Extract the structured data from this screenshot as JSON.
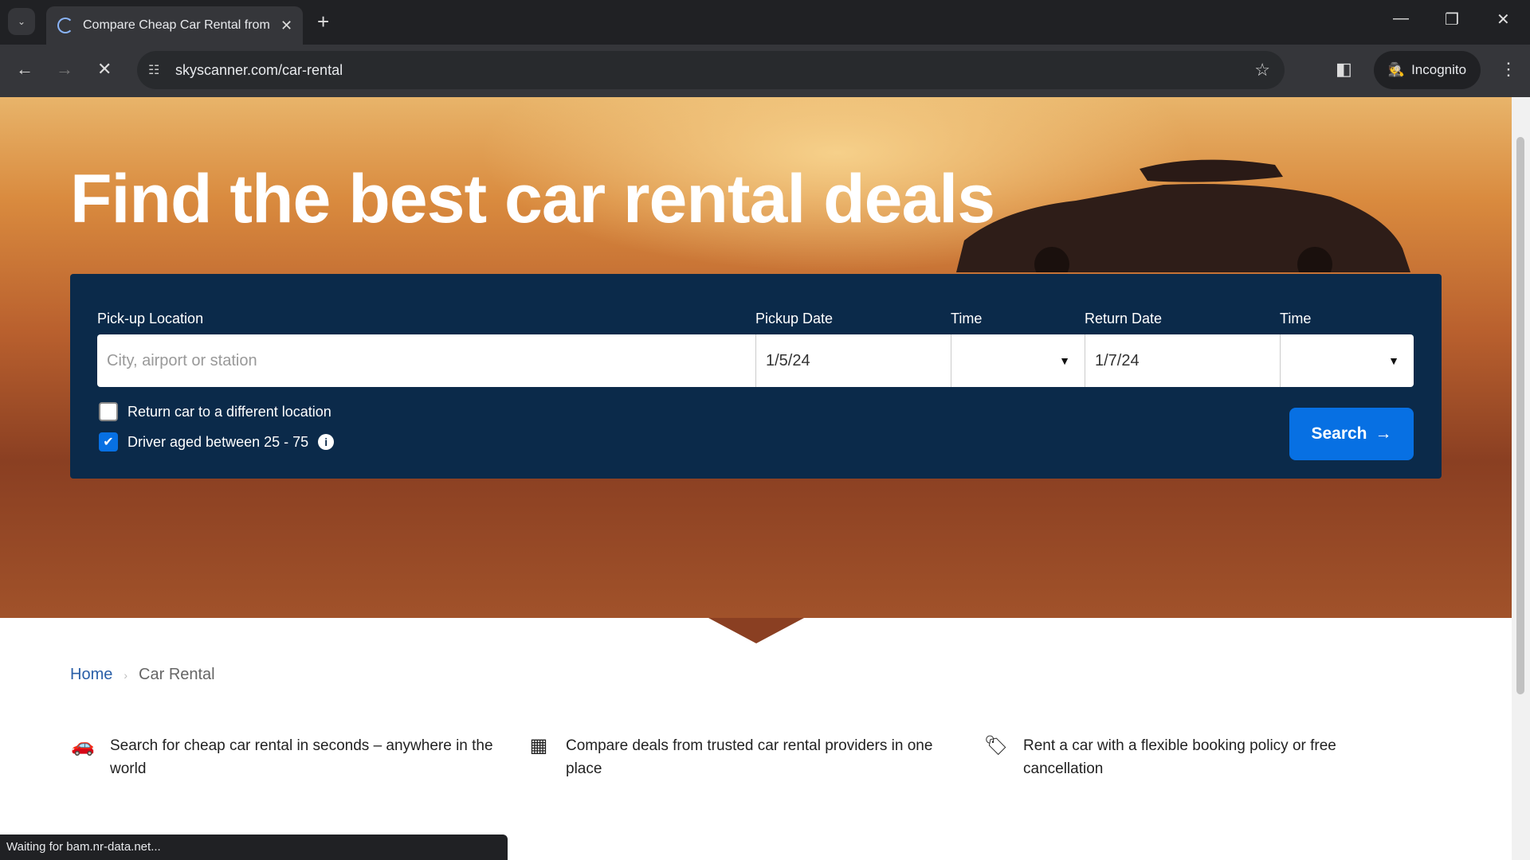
{
  "browser": {
    "tab_title": "Compare Cheap Car Rental from",
    "url": "skyscanner.com/car-rental",
    "profile_label": "Incognito",
    "status_text": "Waiting for bam.nr-data.net..."
  },
  "hero": {
    "title": "Find the best car rental deals"
  },
  "form": {
    "pickup_location_label": "Pick-up Location",
    "pickup_location_placeholder": "City, airport or station",
    "pickup_date_label": "Pickup Date",
    "pickup_date_value": "1/5/24",
    "pickup_time_label": "Time",
    "return_date_label": "Return Date",
    "return_date_value": "1/7/24",
    "return_time_label": "Time",
    "different_location_label": "Return car to a different location",
    "different_location_checked": false,
    "driver_age_label": "Driver aged between 25 - 75",
    "driver_age_checked": true,
    "search_label": "Search"
  },
  "breadcrumb": {
    "home": "Home",
    "current": "Car Rental"
  },
  "features": [
    {
      "icon": "car-icon",
      "text": "Search for cheap car rental in seconds – anywhere in the world"
    },
    {
      "icon": "calendar-icon",
      "text": "Compare deals from trusted car rental providers in one place"
    },
    {
      "icon": "tag-icon",
      "text": "Rent a car with a flexible booking policy or free cancellation"
    }
  ],
  "colors": {
    "panel": "#0b2a4a",
    "accent": "#0770e3"
  }
}
